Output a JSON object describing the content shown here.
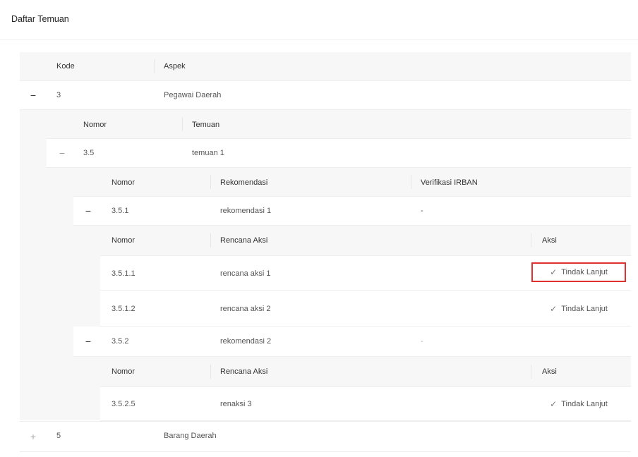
{
  "page": {
    "title": "Daftar Temuan"
  },
  "table": {
    "columns": {
      "kode": "Kode",
      "aspek": "Aspek"
    },
    "rows": [
      {
        "kode": "3",
        "aspek": "Pegawai Daerah",
        "expanded": true
      },
      {
        "kode": "5",
        "aspek": "Barang Daerah",
        "expanded": false
      }
    ]
  },
  "temuan_table": {
    "columns": {
      "nomor": "Nomor",
      "temuan": "Temuan"
    },
    "rows": [
      {
        "nomor": "3.5",
        "temuan": "temuan 1",
        "expanded": true
      }
    ]
  },
  "rekomendasi_table": {
    "columns": {
      "nomor": "Nomor",
      "rekomendasi": "Rekomendasi",
      "verifikasi": "Verifikasi IRBAN"
    },
    "rows": [
      {
        "nomor": "3.5.1",
        "rekomendasi": "rekomendasi 1",
        "verifikasi": "-",
        "expanded": true
      },
      {
        "nomor": "3.5.2",
        "rekomendasi": "rekomendasi 2",
        "verifikasi": "-",
        "expanded": true
      }
    ]
  },
  "rencana_tables": [
    {
      "columns": {
        "nomor": "Nomor",
        "rencana": "Rencana Aksi",
        "aksi": "Aksi"
      },
      "rows": [
        {
          "nomor": "3.5.1.1",
          "rencana": "rencana aksi 1",
          "action": "Tindak Lanjut",
          "highlighted": true
        },
        {
          "nomor": "3.5.1.2",
          "rencana": "rencana aksi 2",
          "action": "Tindak Lanjut",
          "highlighted": false
        }
      ]
    },
    {
      "columns": {
        "nomor": "Nomor",
        "rencana": "Rencana Aksi",
        "aksi": "Aksi"
      },
      "rows": [
        {
          "nomor": "3.5.2.5",
          "rencana": "renaksi 3",
          "action": "Tindak Lanjut",
          "highlighted": false
        }
      ]
    }
  ],
  "icons": {
    "collapse": "−",
    "expand": "+",
    "check": "✓"
  },
  "colors": {
    "highlight": "#e03131",
    "header_bg": "#f7f7f7",
    "nested_bg": "#f7f7f7"
  }
}
